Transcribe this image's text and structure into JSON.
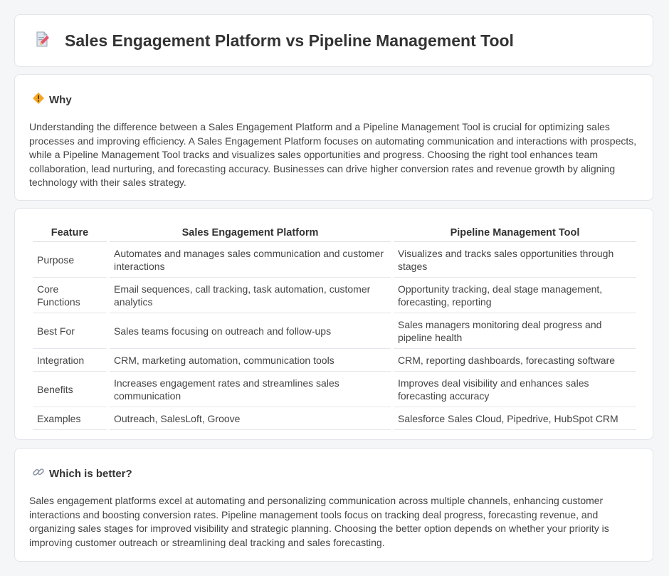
{
  "header": {
    "title": "Sales Engagement Platform vs Pipeline Management Tool",
    "icon": "document-pencil-icon"
  },
  "why": {
    "title": "Why",
    "icon": "warning-diamond-icon",
    "body": "Understanding the difference between a Sales Engagement Platform and a Pipeline Management Tool is crucial for optimizing sales processes and improving efficiency. A Sales Engagement Platform focuses on automating communication and interactions with prospects, while a Pipeline Management Tool tracks and visualizes sales opportunities and progress. Choosing the right tool enhances team collaboration, lead nurturing, and forecasting accuracy. Businesses can drive higher conversion rates and revenue growth by aligning technology with their sales strategy."
  },
  "table": {
    "headers": [
      "Feature",
      "Sales Engagement Platform",
      "Pipeline Management Tool"
    ],
    "rows": [
      [
        "Purpose",
        "Automates and manages sales communication and customer interactions",
        "Visualizes and tracks sales opportunities through stages"
      ],
      [
        "Core Functions",
        "Email sequences, call tracking, task automation, customer analytics",
        "Opportunity tracking, deal stage management, forecasting, reporting"
      ],
      [
        "Best For",
        "Sales teams focusing on outreach and follow-ups",
        "Sales managers monitoring deal progress and pipeline health"
      ],
      [
        "Integration",
        "CRM, marketing automation, communication tools",
        "CRM, reporting dashboards, forecasting software"
      ],
      [
        "Benefits",
        "Increases engagement rates and streamlines sales communication",
        "Improves deal visibility and enhances sales forecasting accuracy"
      ],
      [
        "Examples",
        "Outreach, SalesLoft, Groove",
        "Salesforce Sales Cloud, Pipedrive, HubSpot CRM"
      ]
    ]
  },
  "better": {
    "title": "Which is better?",
    "icon": "link-icon",
    "body": "Sales engagement platforms excel at automating and personalizing communication across multiple channels, enhancing customer interactions and boosting conversion rates. Pipeline management tools focus on tracking deal progress, forecasting revenue, and organizing sales stages for improved visibility and strategic planning. Choosing the better option depends on whether your priority is improving customer outreach or streamlining deal tracking and sales forecasting."
  }
}
